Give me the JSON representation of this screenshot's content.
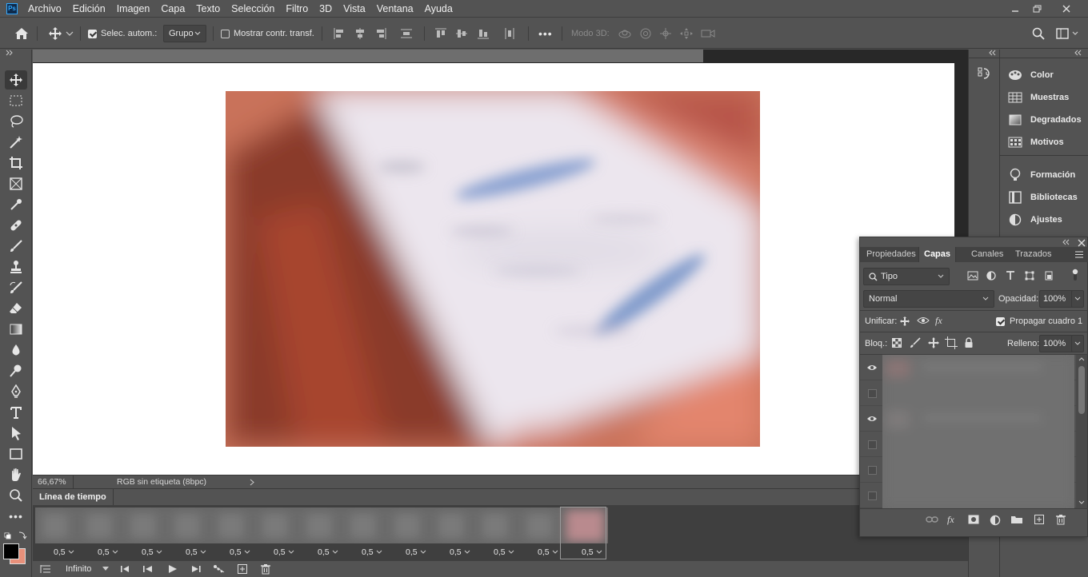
{
  "app": {
    "logo": "Ps",
    "menu": [
      "Archivo",
      "Edición",
      "Imagen",
      "Capa",
      "Texto",
      "Selección",
      "Filtro",
      "3D",
      "Vista",
      "Ventana",
      "Ayuda"
    ]
  },
  "options_bar": {
    "auto_select_label": "Selec. autom.:",
    "auto_select_checked": true,
    "auto_select_value": "Grupo",
    "show_transform_label": "Mostrar contr. transf.",
    "show_transform_checked": false,
    "more_label": "•••",
    "mode_3d_label": "Modo 3D:"
  },
  "status_bar": {
    "zoom": "66,67%",
    "doc_info": "RGB sin etiqueta (8bpc)"
  },
  "timeline": {
    "tab_label": "Línea de tiempo",
    "frame_delays": [
      "0,5",
      "0,5",
      "0,5",
      "0,5",
      "0,5",
      "0,5",
      "0,5",
      "0,5",
      "0,5",
      "0,5",
      "0,5",
      "0,5",
      "0,5"
    ],
    "selected_frame": 13,
    "loop_value": "Infinito"
  },
  "right_panels": {
    "group1": [
      "Color",
      "Muestras",
      "Degradados",
      "Motivos"
    ],
    "group2": [
      "Formación",
      "Bibliotecas",
      "Ajustes"
    ]
  },
  "layers_panel": {
    "tabs": [
      "Propiedades",
      "Capas",
      "Canales",
      "Trazados"
    ],
    "active_tab": "Capas",
    "filter_kind": "Tipo",
    "blend_mode": "Normal",
    "opacity_label": "Opacidad:",
    "opacity_value": "100%",
    "unify_label": "Unificar:",
    "propagate_label": "Propagar cuadro 1",
    "propagate_checked": true,
    "lock_label": "Bloq.:",
    "fill_label": "Relleno:",
    "fill_value": "100%",
    "layer_visibility": [
      true,
      false,
      true,
      false,
      false,
      false
    ]
  },
  "colors": {
    "ui_bg": "#535353",
    "ui_dark": "#3a3a3a",
    "accent": "#31a8ff",
    "foreground_swatch": "#000000",
    "background_swatch": "#e8907a"
  }
}
